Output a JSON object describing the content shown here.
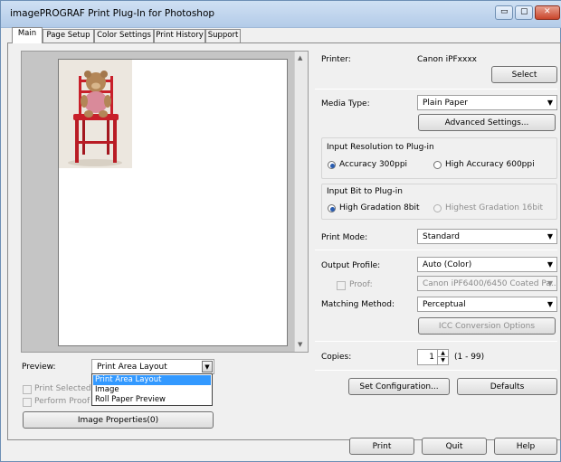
{
  "window": {
    "title": "imagePROGRAF Print Plug-In for Photoshop",
    "minimize_glyph": "▭",
    "maximize_glyph": "▢",
    "close_glyph": "✕"
  },
  "tabs": [
    {
      "label": "Main"
    },
    {
      "label": "Page Setup"
    },
    {
      "label": "Color Settings"
    },
    {
      "label": "Print History"
    },
    {
      "label": "Support"
    }
  ],
  "printer": {
    "label": "Printer:",
    "value": "Canon iPFxxxx",
    "select_label": "Select"
  },
  "media_type": {
    "label": "Media Type:",
    "value": "Plain Paper",
    "advanced_label": "Advanced Settings..."
  },
  "input_resolution": {
    "label": "Input Resolution to Plug-in",
    "options": [
      "Accuracy 300ppi",
      "High Accuracy 600ppi"
    ],
    "selected": "Accuracy 300ppi"
  },
  "input_bit": {
    "label": "Input Bit to Plug-in",
    "options": [
      "High Gradation 8bit",
      "Highest Gradation 16bit"
    ],
    "selected": "High Gradation 8bit"
  },
  "print_mode": {
    "label": "Print Mode:",
    "value": "Standard"
  },
  "output_profile": {
    "label": "Output Profile:",
    "value": "Auto (Color)"
  },
  "proof": {
    "label": "Proof:",
    "value": "Canon iPF6400/6450 Coated Pa...",
    "checked": false
  },
  "matching_method": {
    "label": "Matching Method:",
    "value": "Perceptual",
    "icc_label": "ICC Conversion Options"
  },
  "copies": {
    "label": "Copies:",
    "value": "1",
    "range": "(1 - 99)"
  },
  "set_config_label": "Set Configuration...",
  "defaults_label": "Defaults",
  "preview": {
    "label": "Preview:",
    "value": "Print Area Layout",
    "options": [
      "Print Area Layout",
      "Image",
      "Roll Paper Preview"
    ],
    "highlighted": "Print Area Layout"
  },
  "print_selected_label": "Print Selected Ra",
  "perform_proof_label": "Perform Proof in",
  "image_properties_label": "Image Properties(0)",
  "footer": {
    "print_label": "Print",
    "quit_label": "Quit",
    "help_label": "Help"
  },
  "colors": {
    "title_bar": "#bcd2ec",
    "selection": "#3399ff",
    "radio_dot": "#2a5db0",
    "close_button": "#c9452b"
  }
}
